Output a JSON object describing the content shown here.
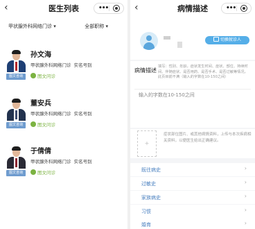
{
  "left": {
    "title": "医生列表",
    "filter_dept": "甲状腺外科网络门诊",
    "filter_title": "全部职称",
    "doctors": [
      {
        "name": "孙文海",
        "dept": "甲状腺外科网络门诊",
        "badge": "实名号别",
        "service": "图文问诊",
        "tag": "图文咨询"
      },
      {
        "name": "董安兵",
        "dept": "甲状腺外科网络门诊",
        "badge": "实名号别",
        "service": "图文问诊",
        "tag": "图文咨询"
      },
      {
        "name": "于倩倩",
        "dept": "甲状腺外科网络门诊",
        "badge": "实名号别",
        "service": "图文问诊",
        "tag": "图文咨询"
      }
    ]
  },
  "right": {
    "title": "病情描述",
    "switch_label": "切换就诊人",
    "desc_label": "病情描述",
    "desc_hint": "填写：性别、年龄，症状发生时间、症状、部位、持续时间、伴随症状、是否用药、是否手术、是否过敏等情况，此页目前不满（输入的字数在10-150之间）",
    "input_placeholder": "输入的字数在10-150之间",
    "upload_hint": "症状部位图片、或其他病情资料，上传与本次疾病相关资料，以便医生给出正确建议。",
    "history": [
      "既往病史",
      "过敏史",
      "家族病史",
      "习惯",
      "婚育"
    ]
  }
}
